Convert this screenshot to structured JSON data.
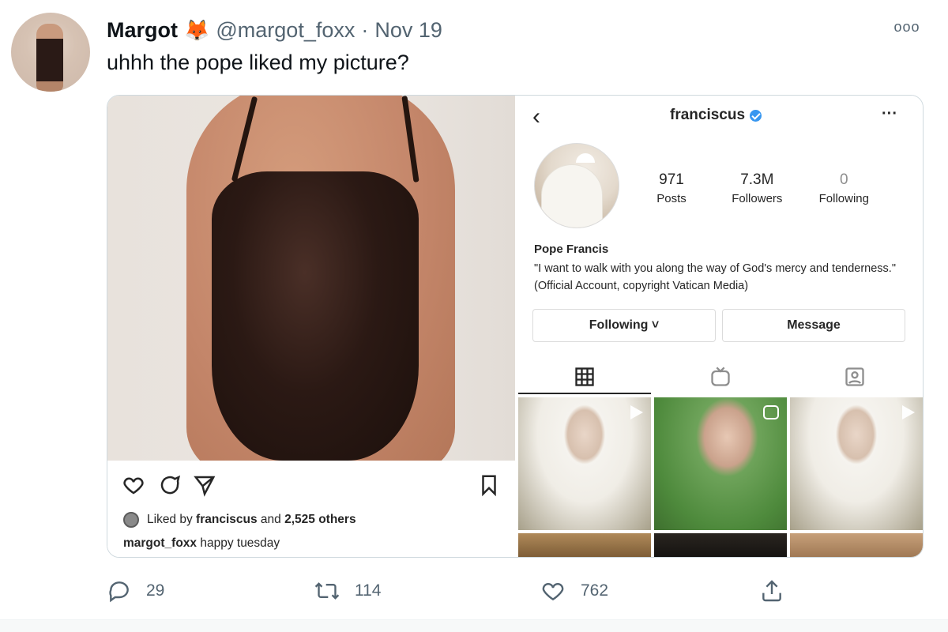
{
  "tweet": {
    "author_name": "Margot",
    "author_emoji": "🦊",
    "handle": "@margot_foxx",
    "separator": "·",
    "date": "Nov 19",
    "more_label": "ooo",
    "text": "uhhh the pope liked my picture?"
  },
  "instagram_post": {
    "liked_by_prefix": "Liked by",
    "liked_by_user": "franciscus",
    "liked_by_middle": "and",
    "liked_by_others": "2,525 others",
    "caption_user": "margot_foxx",
    "caption_text": "happy tuesday"
  },
  "instagram_profile": {
    "back_icon": "‹",
    "username": "franciscus",
    "more_icon": "···",
    "stats": [
      {
        "num": "971",
        "label": "Posts"
      },
      {
        "num": "7.3M",
        "label": "Followers"
      },
      {
        "num": "0",
        "label": "Following"
      }
    ],
    "display_name": "Pope Francis",
    "bio": "\"I want to walk with you along the way of God's mercy and tenderness.\" (Official Account, copyright Vatican Media)",
    "following_button": "Following ˅",
    "message_button": "Message"
  },
  "tweet_actions": {
    "replies": "29",
    "retweets": "114",
    "likes": "762"
  },
  "colors": {
    "twitter_gray": "#536471",
    "ig_text": "#262626",
    "verified_blue": "#3897f0",
    "border": "#cfd9de"
  }
}
